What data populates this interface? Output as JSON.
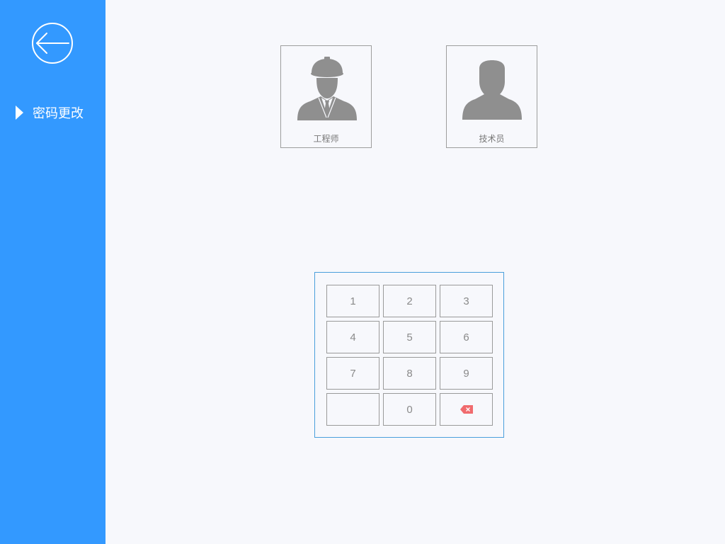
{
  "colors": {
    "sidebar": "#3399ff",
    "background": "#f7f8fc",
    "accent_border": "#4a9fdc",
    "key_border": "#9a9a9a",
    "text_gray": "#8a8a8a",
    "icon_gray": "#8f8f8f",
    "backspace": "#f06b6e"
  },
  "sidebar": {
    "back_icon": "back-arrow-icon",
    "items": [
      {
        "label": "密码更改",
        "icon": "caret-right-icon"
      }
    ]
  },
  "users": [
    {
      "label": "工程师",
      "icon": "engineer-avatar-icon"
    },
    {
      "label": "技术员",
      "icon": "technician-avatar-icon"
    }
  ],
  "keypad": {
    "keys": [
      {
        "label": "1"
      },
      {
        "label": "2"
      },
      {
        "label": "3"
      },
      {
        "label": "4"
      },
      {
        "label": "5"
      },
      {
        "label": "6"
      },
      {
        "label": "7"
      },
      {
        "label": "8"
      },
      {
        "label": "9"
      },
      {
        "label": ""
      },
      {
        "label": "0"
      },
      {
        "label": "",
        "icon": "backspace-icon"
      }
    ]
  }
}
